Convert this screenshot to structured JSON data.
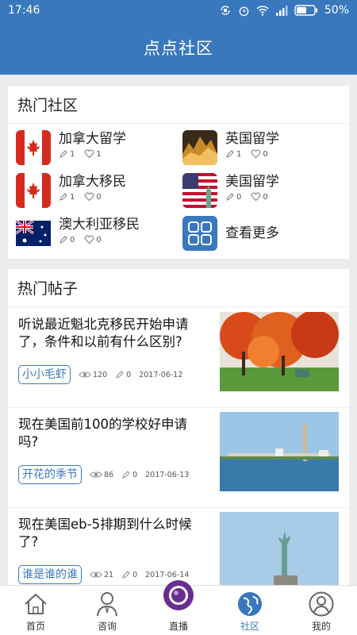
{
  "status": {
    "time": "17:46",
    "battery": "50%"
  },
  "header": {
    "title": "点点社区"
  },
  "hot_communities": {
    "title": "热门社区",
    "items": [
      {
        "name": "加拿大留学",
        "posts": "1",
        "likes": "1",
        "icon": "canada-flag"
      },
      {
        "name": "英国留学",
        "posts": "1",
        "likes": "0",
        "icon": "uk-city-night"
      },
      {
        "name": "加拿大移民",
        "posts": "1",
        "likes": "0",
        "icon": "canada-flag"
      },
      {
        "name": "美国留学",
        "posts": "0",
        "likes": "0",
        "icon": "us-flag-statue"
      },
      {
        "name": "澳大利亚移民",
        "posts": "0",
        "likes": "0",
        "icon": "australia-flag"
      },
      {
        "name": "查看更多",
        "icon": "grid-more"
      }
    ]
  },
  "hot_posts": {
    "title": "热门帖子",
    "items": [
      {
        "title": "听说最近魁北克移民开始申请了，条件和以前有什么区别?",
        "author": "小小毛虾",
        "views": "120",
        "comments": "0",
        "date": "2017-06-12",
        "image": "autumn-trees"
      },
      {
        "title": "现在美国前100的学校好申请吗?",
        "author": "开花的季节",
        "views": "86",
        "comments": "0",
        "date": "2017-06-13",
        "image": "harbor-town"
      },
      {
        "title": "现在美国eb-5排期到什么时候了?",
        "author": "谁是谁的谁",
        "views": "21",
        "comments": "0",
        "date": "2017-06-14",
        "image": "statue-of-liberty"
      }
    ]
  },
  "tabbar": [
    {
      "label": "首页",
      "icon": "home-icon"
    },
    {
      "label": "咨询",
      "icon": "person-icon"
    },
    {
      "label": "直播",
      "icon": "live-camera-icon"
    },
    {
      "label": "社区",
      "icon": "globe-icon",
      "active": true
    },
    {
      "label": "我的",
      "icon": "profile-icon"
    }
  ],
  "colors": {
    "primary": "#3a78bd",
    "background": "#ececec"
  }
}
